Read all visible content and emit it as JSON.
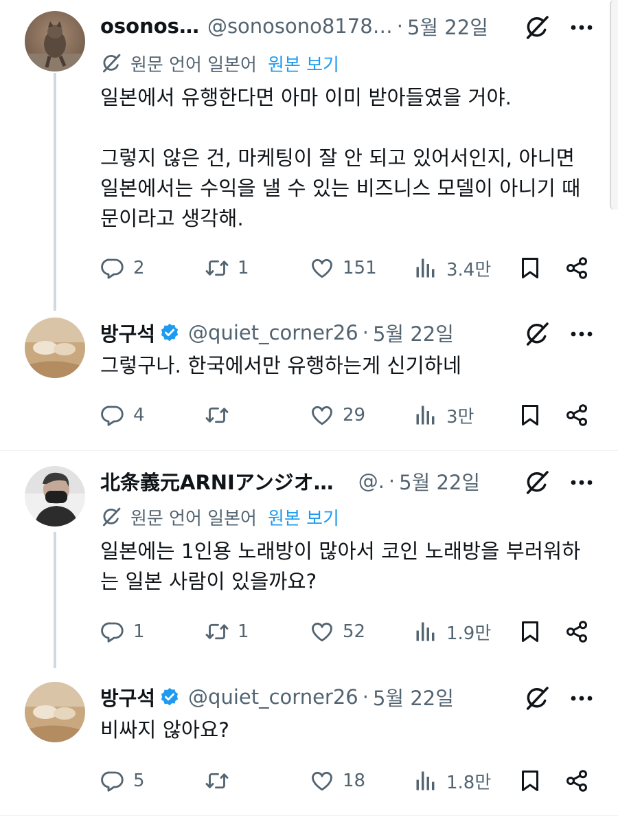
{
  "colors": {
    "text": "#0f1419",
    "muted": "#536471",
    "link": "#1d9bf0",
    "verified": "#1d9bf0",
    "thread_line": "#cfd9de"
  },
  "posts": [
    {
      "name": "osonos…",
      "handle": "@sonosono8178…",
      "dot": "·",
      "time": "5월 22일",
      "verified": false,
      "translate": {
        "source": "원문 언어 일본어",
        "link": "원본 보기"
      },
      "paragraphs": [
        "일본에서 유행한다면 아마 이미 받아들였을 거야.",
        "그렇지 않은 건, 마케팅이 잘 안 되고 있어서인지, 아니면 일본에서는 수익을 낼 수 있는 비즈니스 모델이 아니기 때문이라고 생각해."
      ],
      "replies": "2",
      "reposts": "1",
      "likes": "151",
      "views": "3.4만",
      "avatar_icon": "cat-avatar"
    },
    {
      "name": "방구석",
      "handle": "@quiet_corner26",
      "dot": "·",
      "time": "5월 22일",
      "verified": true,
      "paragraphs": [
        "그렇구나. 한국에서만 유행하는게 신기하네"
      ],
      "replies": "4",
      "reposts": "",
      "likes": "29",
      "views": "3만",
      "avatar_icon": "bedroom-avatar"
    },
    {
      "name": "北条義元ARNIアンジオ…",
      "handle": "@.",
      "dot": "·",
      "time": "5월 22일",
      "verified": false,
      "translate": {
        "source": "원문 언어 일본어",
        "link": "원본 보기"
      },
      "paragraphs": [
        "일본에는 1인용 노래방이 많아서 코인 노래방을 부러워하는 일본 사람이 있을까요?"
      ],
      "replies": "1",
      "reposts": "1",
      "likes": "52",
      "views": "1.9만",
      "avatar_icon": "masked-person-avatar"
    },
    {
      "name": "방구석",
      "handle": "@quiet_corner26",
      "dot": "·",
      "time": "5월 22일",
      "verified": true,
      "paragraphs": [
        "비싸지 않아요?"
      ],
      "replies": "5",
      "reposts": "",
      "likes": "18",
      "views": "1.8만",
      "avatar_icon": "bedroom-avatar"
    }
  ]
}
